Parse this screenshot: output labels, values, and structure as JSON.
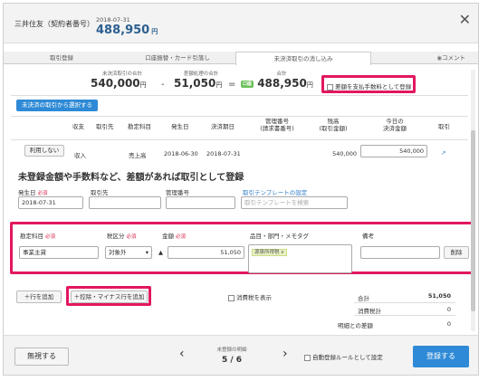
{
  "header": {
    "account_label": "三井住友（契約者番号）",
    "date": "2018-07-31",
    "amount": "488,950",
    "amount_unit": "円",
    "close_icon": "close-icon"
  },
  "tabs": [
    {
      "label": "取引登録"
    },
    {
      "label": "口座振替・カード引落し"
    },
    {
      "label": "未決済取引の消し込み"
    },
    {
      "label": "コメント",
      "icon": "comment-icon"
    }
  ],
  "summary": {
    "unsettled_caption": "未決済取引の合計",
    "unsettled_value": "540,000",
    "unregistered_caption": "差額処理の合計",
    "unregistered_value": "51,050",
    "total_caption": "合計",
    "total_chip": "口座",
    "total_value": "488,950",
    "unit": "円",
    "minus": "-",
    "equals": "=",
    "fee_checkbox_label": "差額を支払手数料として登録"
  },
  "select_unsettled_button": "未決済の取引から選択する",
  "table": {
    "headers": [
      "収支",
      "取引先",
      "勘定科目",
      "発生日",
      "決済期日",
      "管理番号\n(請求書番号)",
      "残高\n(取引金額)",
      "今日の\n決済金額",
      "取引"
    ],
    "row": {
      "toggle_button": "利用しない",
      "type": "収入",
      "partner": "",
      "account": "売上高",
      "issue_date": "2018-06-30",
      "due_date": "2018-07-31",
      "mgmt_no": "",
      "balance": "540,000",
      "settle_amount": "540,000"
    }
  },
  "register": {
    "title": "未登録金額や手数料など、差額があれば取引として登録",
    "date_label": "発生日",
    "required": "必須",
    "date_value": "2018-07-31",
    "partner_label": "取引先",
    "mgmt_label": "管理番号",
    "template_link": "取引テンプレートの設定",
    "template_placeholder": "取引テンプレートを検索"
  },
  "detail": {
    "account_label": "勘定科目",
    "tax_label": "税区分",
    "amount_label": "金額",
    "item_label": "品目・部門・メモタグ",
    "note_label": "備考",
    "account_value": "事業主貸",
    "tax_value": "対象外",
    "amount_value": "51,050",
    "tag_value": "源泉所得税",
    "tag_remove": "x",
    "delete_button": "削除"
  },
  "actions": {
    "add_row": "行を追加",
    "add_minus_row": "控除・マイナス行を追加",
    "show_tax": "消費税を表示"
  },
  "totals": {
    "sum_label": "合計",
    "sum_value": "51,050",
    "tax_label": "消費税計",
    "tax_value": "0",
    "diff_label": "明細との差額",
    "diff_value": "0"
  },
  "footer": {
    "ignore_button": "無視する",
    "pager_caption": "未登録の明細",
    "pager_value": "5 / 6",
    "auto_rule_label": "自動登録ルールとして設定",
    "register_button": "登録する"
  }
}
